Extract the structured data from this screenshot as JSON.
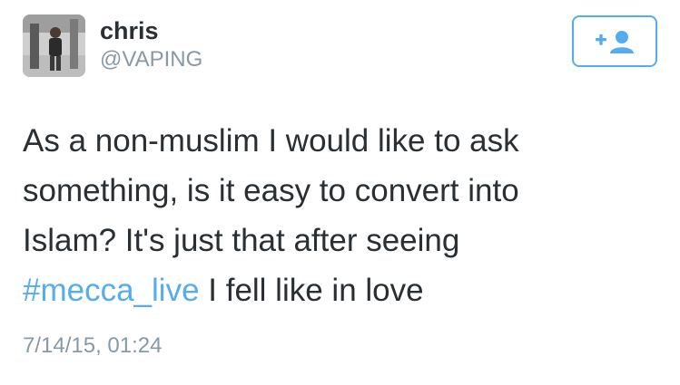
{
  "user": {
    "display_name": "chris",
    "handle": "@VAPING"
  },
  "actions": {
    "follow_icon": "add-user-icon"
  },
  "tweet": {
    "text_lines": [
      "As a non-muslim I would like to ask",
      "something, is it easy to convert into",
      "Islam? It's just that after seeing"
    ],
    "hashtag": "#mecca_live",
    "text_after_hashtag": " I fell like in love",
    "timestamp": "7/14/15, 01:24"
  },
  "colors": {
    "accent": "#55acee",
    "text": "#292f33",
    "muted": "#8899a6"
  }
}
